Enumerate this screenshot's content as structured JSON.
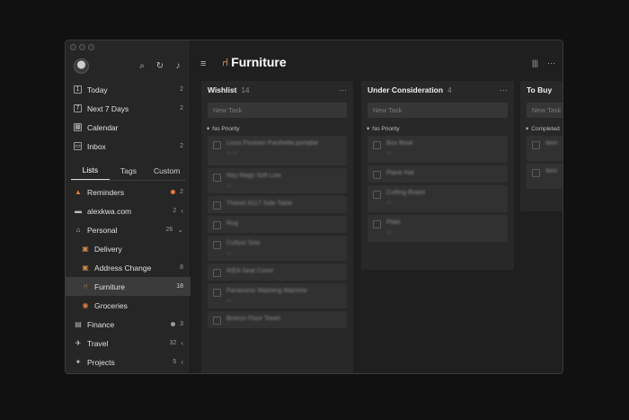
{
  "sidebar": {
    "top_icons": [
      "search-icon",
      "sync-icon",
      "bell-icon"
    ],
    "nav": [
      {
        "label": "Today",
        "count": "2",
        "icon": "today-icon"
      },
      {
        "label": "Next 7 Days",
        "count": "2",
        "icon": "next7-icon"
      },
      {
        "label": "Calendar",
        "count": "",
        "icon": "calendar-icon"
      },
      {
        "label": "Inbox",
        "count": "2",
        "icon": "inbox-icon"
      }
    ],
    "tabs": [
      "Lists",
      "Tags",
      "Custom"
    ],
    "lists": [
      {
        "label": "Reminders",
        "count": "2",
        "dot": "#e07b3a"
      },
      {
        "label": "alexkwa.com",
        "count": "2"
      },
      {
        "label": "Personal",
        "count": "26"
      },
      {
        "label": "Delivery",
        "count": ""
      },
      {
        "label": "Address Change",
        "count": "8"
      },
      {
        "label": "Furniture",
        "count": "18"
      },
      {
        "label": "Groceries",
        "count": ""
      },
      {
        "label": "Finance",
        "count": "3",
        "dot": "#9a9a9a"
      },
      {
        "label": "Travel",
        "count": "32"
      },
      {
        "label": "Projects",
        "count": "5"
      }
    ]
  },
  "main": {
    "title": "Furniture",
    "columns": [
      {
        "name": "Wishlist",
        "count": "14",
        "new_task": "New Task",
        "group": "No Priority",
        "cards": [
          "Louis Poulsen Panthella portable",
          "Hay Mags Soft Low",
          "Thonet 9117 Side Table",
          "Rug",
          "Cuttyst Sow",
          "IKEA Seat Cover",
          "Panasonic Washing Machine",
          "Breeze Floor Towel"
        ]
      },
      {
        "name": "Under Consideration",
        "count": "4",
        "new_task": "New Task",
        "group": "No Priority",
        "cards": [
          "Box Bowl",
          "Plane Hat",
          "Cutting Board",
          "Plate"
        ]
      },
      {
        "name": "To Buy",
        "count": "",
        "new_task": "New Task",
        "group": "Completed",
        "cards": [
          "Item",
          "Item"
        ]
      }
    ]
  },
  "colors": {
    "accent": "#e07b3a",
    "selected_bg": "#3b3b3b",
    "window_bg": "#1f1f1f"
  }
}
